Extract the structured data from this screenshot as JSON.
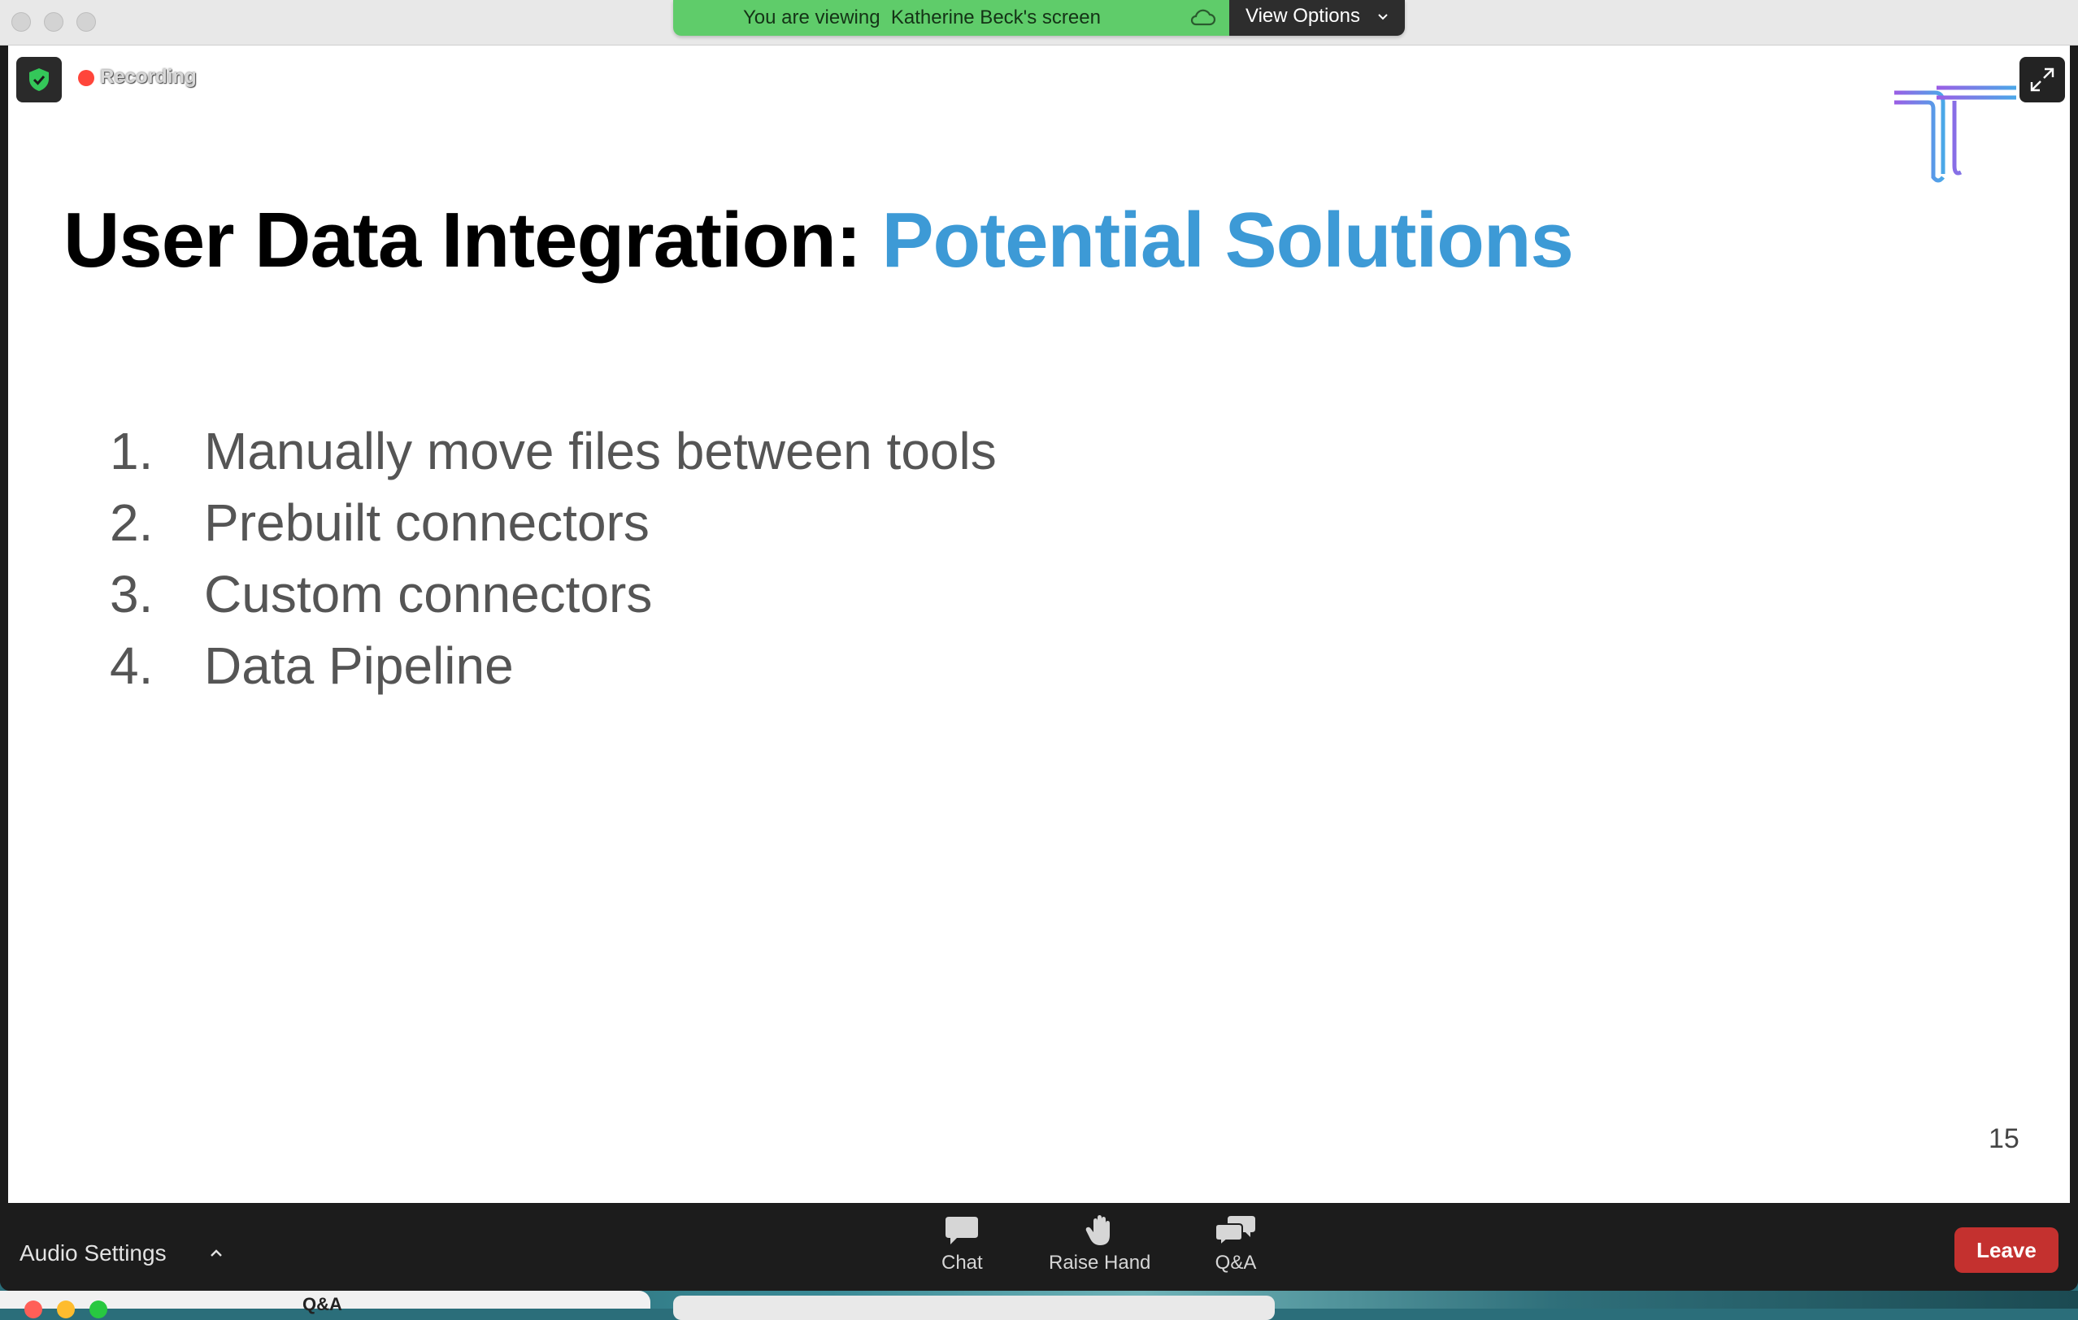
{
  "banner": {
    "viewing_text": "You are viewing  Katherine Beck's screen",
    "view_options_label": "View Options"
  },
  "meeting": {
    "recording_label": "Recording"
  },
  "slide": {
    "title_main": "User Data Integration: ",
    "title_accent": "Potential Solutions",
    "items": [
      {
        "num": "1.",
        "text": "Manually move files between tools"
      },
      {
        "num": "2.",
        "text": "Prebuilt connectors"
      },
      {
        "num": "3.",
        "text": "Custom connectors"
      },
      {
        "num": "4.",
        "text": "Data Pipeline"
      }
    ],
    "page_number": "15"
  },
  "toolbar": {
    "audio_settings_label": "Audio Settings",
    "chat_label": "Chat",
    "raise_hand_label": "Raise Hand",
    "qa_label": "Q&A",
    "leave_label": "Leave"
  },
  "background_window": {
    "title": "Q&A"
  },
  "colors": {
    "accent": "#3d9ad6",
    "banner_green": "#5fcc6a",
    "leave_red": "#c4312f",
    "recording_red": "#ff453a"
  }
}
